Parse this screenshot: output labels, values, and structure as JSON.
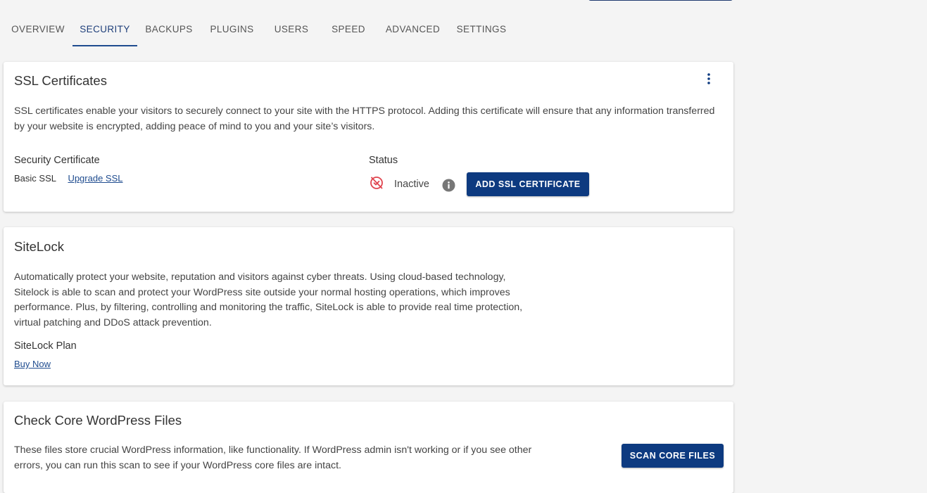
{
  "tabs": [
    {
      "label": "OVERVIEW"
    },
    {
      "label": "SECURITY"
    },
    {
      "label": "BACKUPS"
    },
    {
      "label": "PLUGINS"
    },
    {
      "label": "USERS"
    },
    {
      "label": "SPEED"
    },
    {
      "label": "ADVANCED"
    },
    {
      "label": "SETTINGS"
    }
  ],
  "active_tab": "SECURITY",
  "colors": {
    "primary": "#0d3a80",
    "inactive_status": "#e0454f",
    "info_icon": "#777777"
  },
  "ssl": {
    "title": "SSL Certificates",
    "description": "SSL certificates enable your visitors to securely connect to your site with the HTTPS protocol. Adding this certificate will ensure that any information transferred by your website is encrypted, adding peace of mind to you and your site’s visitors.",
    "cert_label": "Security Certificate",
    "cert_value": "Basic SSL",
    "upgrade_link": "Upgrade SSL",
    "status_label": "Status",
    "status_value": "Inactive",
    "add_button": "ADD SSL CERTIFICATE"
  },
  "sitelock": {
    "title": "SiteLock",
    "description": "Automatically protect your website, reputation and visitors against cyber threats. Using cloud-based technology, Sitelock is able to scan and protect your WordPress site outside your normal hosting operations, which improves performance. Plus, by filtering, controlling and monitoring the traffic, SiteLock is able to provide real time protection, virtual patching and DDoS attack prevention.",
    "plan_label": "SiteLock Plan",
    "buy_link": "Buy Now"
  },
  "core_files": {
    "title": "Check Core WordPress Files",
    "description": "These files store crucial WordPress information, like functionality. If WordPress admin isn't working or if you see other errors, you can run this scan to see if your WordPress core files are intact.",
    "scan_button": "SCAN CORE FILES"
  }
}
